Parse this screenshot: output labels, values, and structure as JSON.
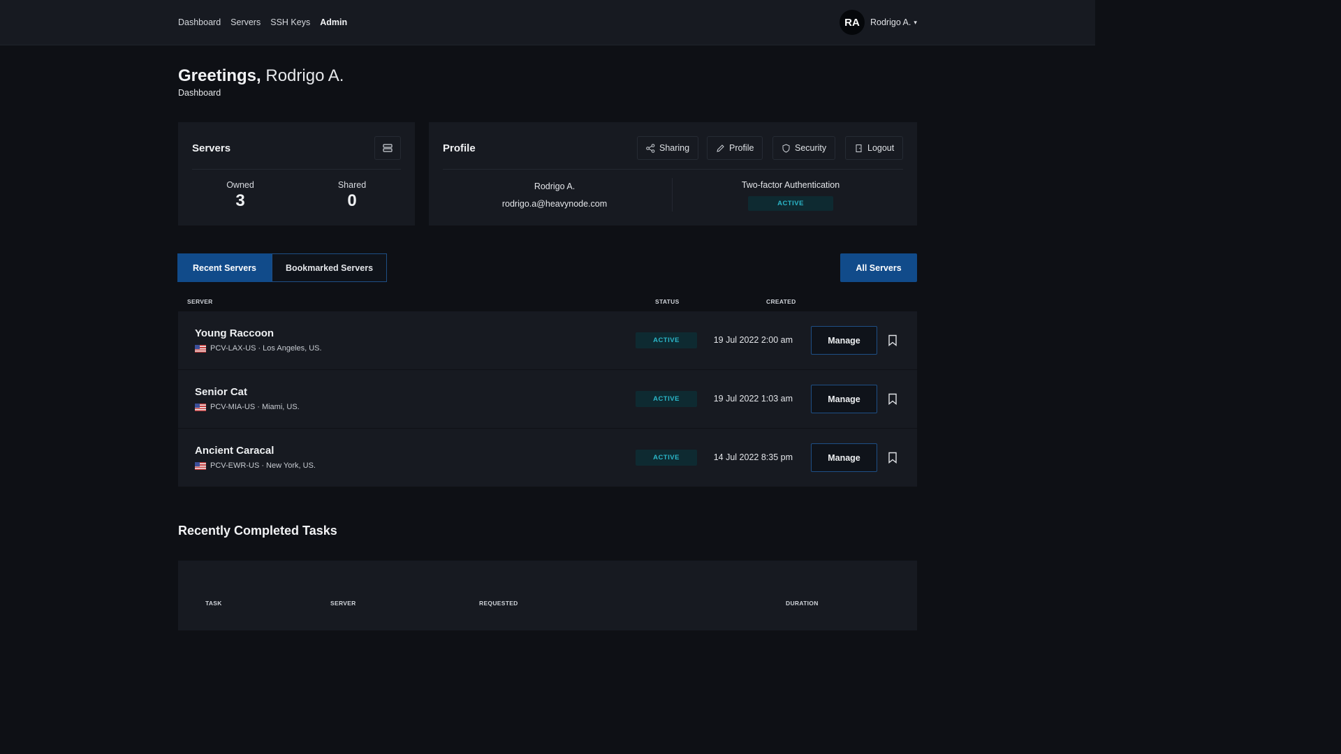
{
  "nav": {
    "items": [
      "Dashboard",
      "Servers",
      "SSH Keys",
      "Admin"
    ]
  },
  "user": {
    "initials": "RA",
    "name": "Rodrigo A."
  },
  "header": {
    "greeting": "Greetings,",
    "name": "Rodrigo A.",
    "breadcrumb": "Dashboard"
  },
  "servers_card": {
    "title": "Servers",
    "owned_label": "Owned",
    "owned_value": "3",
    "shared_label": "Shared",
    "shared_value": "0"
  },
  "profile_card": {
    "title": "Profile",
    "buttons": {
      "sharing": "Sharing",
      "profile": "Profile",
      "security": "Security",
      "logout": "Logout"
    },
    "name": "Rodrigo A.",
    "email": "rodrigo.a@heavynode.com",
    "twofa_label": "Two-factor Authentication",
    "twofa_status": "ACTIVE"
  },
  "tabs": {
    "recent": "Recent Servers",
    "bookmarked": "Bookmarked Servers"
  },
  "all_servers_label": "All Servers",
  "table": {
    "headers": {
      "server": "SERVER",
      "status": "STATUS",
      "created": "CREATED"
    },
    "manage_label": "Manage",
    "rows": [
      {
        "name": "Young Raccoon",
        "sub": "PCV-LAX-US · Los Angeles, US.",
        "status": "ACTIVE",
        "created": "19 Jul 2022 2:00 am"
      },
      {
        "name": "Senior Cat",
        "sub": "PCV-MIA-US · Miami, US.",
        "status": "ACTIVE",
        "created": "19 Jul 2022 1:03 am"
      },
      {
        "name": "Ancient Caracal",
        "sub": "PCV-EWR-US · New York, US.",
        "status": "ACTIVE",
        "created": "14 Jul 2022 8:35 pm"
      }
    ]
  },
  "tasks": {
    "title": "Recently Completed Tasks",
    "headers": {
      "task": "TASK",
      "server": "SERVER",
      "requested": "REQUESTED",
      "duration": "DURATION"
    }
  },
  "colors": {
    "accent": "#114b8a",
    "active_text": "#2bb7c9",
    "active_bg": "#0e2a31",
    "card_bg": "#171a21",
    "page_bg": "#0e1015"
  },
  "icons": {
    "servers_card": "server-icon",
    "sharing": "share-icon",
    "profile": "pencil-icon",
    "security": "shield-icon",
    "logout": "logout-icon",
    "row": "bookmark-icon",
    "flag": "us-flag-icon",
    "user_menu": "caret-down-icon"
  }
}
